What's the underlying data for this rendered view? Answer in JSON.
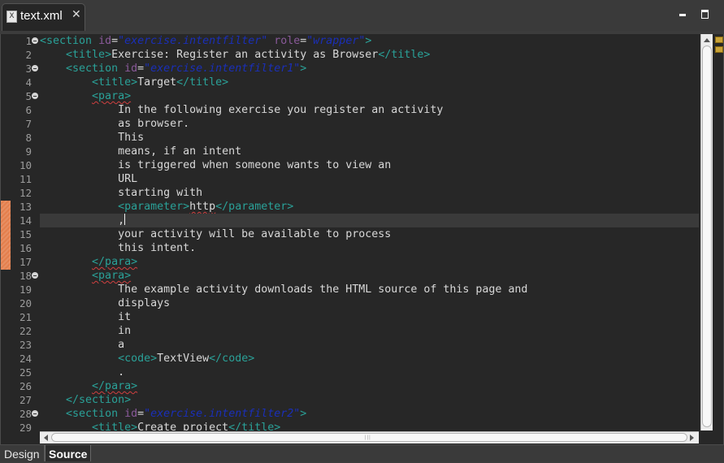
{
  "editor_tab": {
    "title": "text.xml",
    "close_glyph": "✕",
    "icon": "xml-file-icon"
  },
  "window_controls": {
    "minimize_icon": "minimize-icon",
    "maximize_icon": "maximize-icon"
  },
  "bottom_tabs": [
    {
      "label": "Design",
      "active": false
    },
    {
      "label": "Source",
      "active": true
    }
  ],
  "cursor": {
    "line": 14
  },
  "colors": {
    "tag": "#2aa198",
    "attribute_name": "#8a5a9a",
    "attribute_value": "#1a2fb8",
    "text": "#d8d8d8",
    "line_number": "#9c9c9c",
    "change_marker": "#e47f4d",
    "background": "#272727"
  },
  "code_lines": [
    {
      "n": "1",
      "fold": true,
      "indent": 0,
      "segs": [
        {
          "t": "<section ",
          "c": "tag"
        },
        {
          "t": "id",
          "c": "aname"
        },
        {
          "t": "=",
          "c": "eq"
        },
        {
          "t": "\"exercise.intentfilter\"",
          "c": "aval"
        },
        {
          "t": " ",
          "c": "tag"
        },
        {
          "t": "role",
          "c": "aname"
        },
        {
          "t": "=",
          "c": "eq"
        },
        {
          "t": "\"wrapper\"",
          "c": "aval"
        },
        {
          "t": ">",
          "c": "tag"
        }
      ]
    },
    {
      "n": "2",
      "fold": false,
      "indent": 1,
      "segs": [
        {
          "t": "<title>",
          "c": "tag"
        },
        {
          "t": "Exercise: Register an activity as Browser",
          "c": "text"
        },
        {
          "t": "</title>",
          "c": "tag"
        }
      ]
    },
    {
      "n": "3",
      "fold": true,
      "indent": 1,
      "segs": [
        {
          "t": "<section ",
          "c": "tag"
        },
        {
          "t": "id",
          "c": "aname"
        },
        {
          "t": "=",
          "c": "eq"
        },
        {
          "t": "\"exercise.intentfilter1\"",
          "c": "aval"
        },
        {
          "t": ">",
          "c": "tag"
        }
      ]
    },
    {
      "n": "4",
      "fold": false,
      "indent": 2,
      "segs": [
        {
          "t": "<title>",
          "c": "tag"
        },
        {
          "t": "Target",
          "c": "text"
        },
        {
          "t": "</title>",
          "c": "tag"
        }
      ]
    },
    {
      "n": "5",
      "fold": true,
      "indent": 2,
      "segs": [
        {
          "t": "<para>",
          "c": "tag",
          "sq": true
        }
      ]
    },
    {
      "n": "6",
      "fold": false,
      "indent": 3,
      "segs": [
        {
          "t": "In the following exercise you register an activity",
          "c": "text"
        }
      ]
    },
    {
      "n": "7",
      "fold": false,
      "indent": 3,
      "segs": [
        {
          "t": "as browser.",
          "c": "text"
        }
      ]
    },
    {
      "n": "8",
      "fold": false,
      "indent": 3,
      "segs": [
        {
          "t": "This",
          "c": "text"
        }
      ]
    },
    {
      "n": "9",
      "fold": false,
      "indent": 3,
      "segs": [
        {
          "t": "means, if an intent",
          "c": "text"
        }
      ]
    },
    {
      "n": "10",
      "fold": false,
      "indent": 3,
      "segs": [
        {
          "t": "is triggered when someone wants to view an",
          "c": "text"
        }
      ]
    },
    {
      "n": "11",
      "fold": false,
      "indent": 3,
      "segs": [
        {
          "t": "URL",
          "c": "text"
        }
      ]
    },
    {
      "n": "12",
      "fold": false,
      "indent": 3,
      "segs": [
        {
          "t": "starting with",
          "c": "text"
        }
      ]
    },
    {
      "n": "13",
      "fold": false,
      "indent": 3,
      "segs": [
        {
          "t": "<parameter>",
          "c": "tag"
        },
        {
          "t": "http",
          "c": "text",
          "sq": true
        },
        {
          "t": "</parameter>",
          "c": "tag"
        }
      ]
    },
    {
      "n": "14",
      "fold": false,
      "indent": 3,
      "segs": [
        {
          "t": ",",
          "c": "text"
        }
      ]
    },
    {
      "n": "15",
      "fold": false,
      "indent": 3,
      "segs": [
        {
          "t": "your activity will be available to process",
          "c": "text"
        }
      ]
    },
    {
      "n": "16",
      "fold": false,
      "indent": 3,
      "segs": [
        {
          "t": "this intent.",
          "c": "text"
        }
      ]
    },
    {
      "n": "17",
      "fold": false,
      "indent": 2,
      "segs": [
        {
          "t": "</para>",
          "c": "tag",
          "sq": true
        }
      ]
    },
    {
      "n": "18",
      "fold": true,
      "indent": 2,
      "segs": [
        {
          "t": "<para>",
          "c": "tag",
          "sq": true
        }
      ]
    },
    {
      "n": "19",
      "fold": false,
      "indent": 3,
      "segs": [
        {
          "t": "The example activity downloads the HTML source of this page and",
          "c": "text"
        }
      ]
    },
    {
      "n": "20",
      "fold": false,
      "indent": 3,
      "segs": [
        {
          "t": "displays",
          "c": "text"
        }
      ]
    },
    {
      "n": "21",
      "fold": false,
      "indent": 3,
      "segs": [
        {
          "t": "it",
          "c": "text"
        }
      ]
    },
    {
      "n": "22",
      "fold": false,
      "indent": 3,
      "segs": [
        {
          "t": "in",
          "c": "text"
        }
      ]
    },
    {
      "n": "23",
      "fold": false,
      "indent": 3,
      "segs": [
        {
          "t": "a",
          "c": "text"
        }
      ]
    },
    {
      "n": "24",
      "fold": false,
      "indent": 3,
      "segs": [
        {
          "t": "<code>",
          "c": "tag"
        },
        {
          "t": "TextView",
          "c": "text"
        },
        {
          "t": "</code>",
          "c": "tag"
        }
      ]
    },
    {
      "n": "25",
      "fold": false,
      "indent": 3,
      "segs": [
        {
          "t": ".",
          "c": "text"
        }
      ]
    },
    {
      "n": "26",
      "fold": false,
      "indent": 2,
      "segs": [
        {
          "t": "</para>",
          "c": "tag",
          "sq": true
        }
      ]
    },
    {
      "n": "27",
      "fold": false,
      "indent": 1,
      "segs": [
        {
          "t": "</section>",
          "c": "tag"
        }
      ]
    },
    {
      "n": "28",
      "fold": true,
      "indent": 1,
      "segs": [
        {
          "t": "<section ",
          "c": "tag"
        },
        {
          "t": "id",
          "c": "aname"
        },
        {
          "t": "=",
          "c": "eq"
        },
        {
          "t": "\"exercise.intentfilter2\"",
          "c": "aval"
        },
        {
          "t": ">",
          "c": "tag"
        }
      ]
    },
    {
      "n": "29",
      "fold": false,
      "indent": 2,
      "segs": [
        {
          "t": "<title>",
          "c": "tag"
        },
        {
          "t": "Create project",
          "c": "text"
        },
        {
          "t": "</title>",
          "c": "tag"
        }
      ]
    }
  ]
}
